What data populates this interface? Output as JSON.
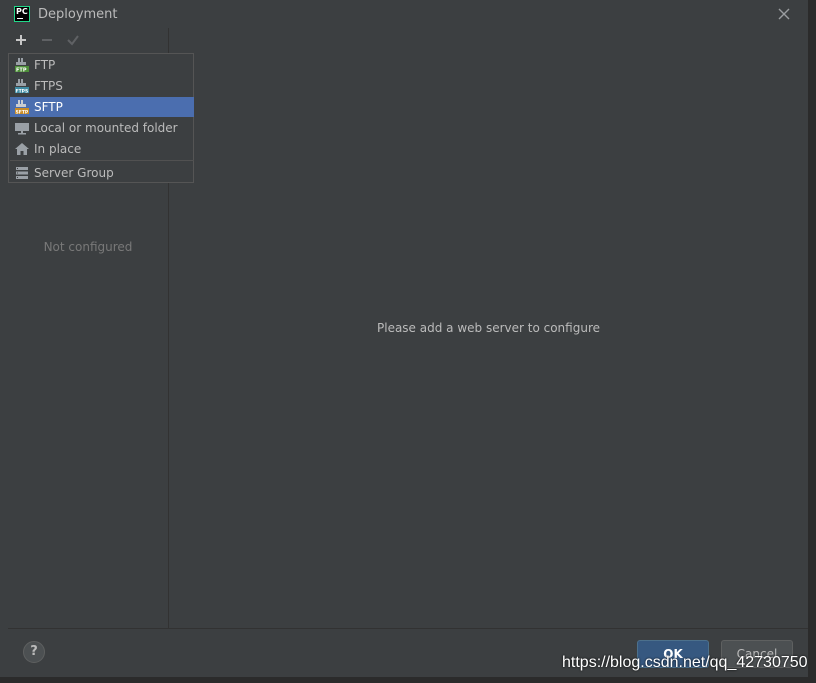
{
  "window": {
    "title": "Deployment",
    "app_logo_text": "PC"
  },
  "toolbar": {
    "add_icon": "plus-icon",
    "remove_icon": "minus-icon",
    "apply_icon": "check-icon"
  },
  "left_panel": {
    "empty_text": "Not configured"
  },
  "main_panel": {
    "empty_text": "Please add a web server to configure"
  },
  "add_menu": {
    "items": [
      {
        "label": "FTP",
        "icon": "ftp-icon",
        "selected": false
      },
      {
        "label": "FTPS",
        "icon": "ftps-icon",
        "selected": false
      },
      {
        "label": "SFTP",
        "icon": "sftp-icon",
        "selected": true
      },
      {
        "label": "Local or mounted folder",
        "icon": "local-folder-icon",
        "selected": false
      },
      {
        "label": "In place",
        "icon": "home-icon",
        "selected": false
      },
      {
        "label": "Server Group",
        "icon": "server-group-icon",
        "selected": false
      }
    ]
  },
  "buttons": {
    "help": "?",
    "ok": "OK",
    "cancel": "Cancel"
  },
  "watermark": "https://blog.csdn.net/qq_42730750",
  "colors": {
    "background": "#3c3f41",
    "selection": "#4b6eaf",
    "ok_button": "#365880",
    "text": "#bbbbbb"
  }
}
